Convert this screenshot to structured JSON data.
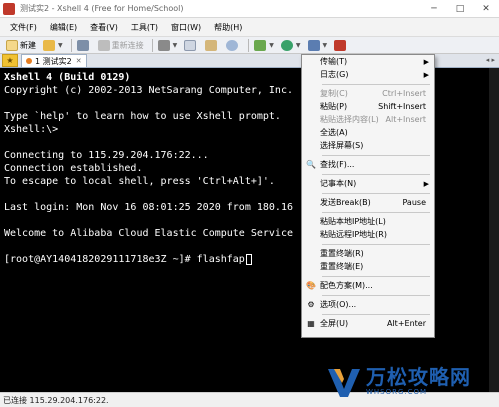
{
  "window": {
    "title": "测试实2 - Xshell 4 (Free for Home/School)",
    "minimize_glyph": "─",
    "maximize_glyph": "□",
    "close_glyph": "✕"
  },
  "menubar": {
    "items": [
      "文件(F)",
      "编辑(E)",
      "查看(V)",
      "工具(T)",
      "窗口(W)",
      "帮助(H)"
    ]
  },
  "toolbar": {
    "new_label": "新建",
    "reconnect_label": "重新连接"
  },
  "tabs": {
    "active_label": "1 测试实2",
    "close_glyph": "✕",
    "nav_glyph": "◂ ▸"
  },
  "terminal": {
    "lines": [
      "Xshell 4 (Build 0129)",
      "Copyright (c) 2002-2013 NetSarang Computer, Inc.",
      "",
      "Type `help' to learn how to use Xshell prompt.",
      "Xshell:\\>",
      "",
      "Connecting to 115.29.204.176:22...",
      "Connection established.",
      "To escape to local shell, press 'Ctrl+Alt+]'.",
      "",
      "Last login: Mon Nov 16 08:01:25 2020 from 180.16",
      "",
      "Welcome to Alibaba Cloud Elastic Compute Service",
      "",
      "[root@AY1404182029111718e3Z ~]# flashfap"
    ]
  },
  "context_menu": {
    "items": [
      {
        "label": "传输(T)",
        "shortcut": "",
        "submenu": true,
        "disabled": false
      },
      {
        "label": "日志(G)",
        "shortcut": "",
        "submenu": true,
        "disabled": false
      },
      {
        "sep": true
      },
      {
        "label": "复制(C)",
        "shortcut": "Ctrl+Insert",
        "submenu": false,
        "disabled": true
      },
      {
        "label": "粘贴(P)",
        "shortcut": "Shift+Insert",
        "submenu": false,
        "disabled": false
      },
      {
        "label": "粘贴选择内容(L)",
        "shortcut": "Alt+Insert",
        "submenu": false,
        "disabled": true
      },
      {
        "label": "全选(A)",
        "shortcut": "",
        "submenu": false,
        "disabled": false
      },
      {
        "label": "选择屏幕(S)",
        "shortcut": "",
        "submenu": false,
        "disabled": false
      },
      {
        "sep": true
      },
      {
        "label": "查找(F)...",
        "shortcut": "",
        "submenu": false,
        "disabled": false,
        "icon": "🔍"
      },
      {
        "sep": true
      },
      {
        "label": "记事本(N)",
        "shortcut": "",
        "submenu": true,
        "disabled": false
      },
      {
        "sep": true
      },
      {
        "label": "发送Break(B)",
        "shortcut": "Pause",
        "submenu": false,
        "disabled": false
      },
      {
        "sep": true
      },
      {
        "label": "粘贴本地IP地址(L)",
        "shortcut": "",
        "submenu": false,
        "disabled": false
      },
      {
        "label": "粘贴远程IP地址(R)",
        "shortcut": "",
        "submenu": false,
        "disabled": false
      },
      {
        "sep": true
      },
      {
        "label": "重置终端(R)",
        "shortcut": "",
        "submenu": false,
        "disabled": false
      },
      {
        "label": "重置终端(E)",
        "shortcut": "",
        "submenu": false,
        "disabled": false
      },
      {
        "sep": true
      },
      {
        "label": "配色方案(M)...",
        "shortcut": "",
        "submenu": false,
        "disabled": false,
        "icon": "🎨"
      },
      {
        "sep": true
      },
      {
        "label": "选项(O)...",
        "shortcut": "",
        "submenu": false,
        "disabled": false,
        "icon": "⚙"
      },
      {
        "sep": true
      },
      {
        "label": "全屏(U)",
        "shortcut": "Alt+Enter",
        "submenu": false,
        "disabled": false,
        "icon": "▦"
      }
    ]
  },
  "statusbar": {
    "text": "已连接 115.29.204.176:22."
  },
  "watermark": {
    "title": "万松攻略网",
    "subtitle": "WHSORG.COM"
  },
  "colors": {
    "terminal_bg": "#000000",
    "terminal_fg": "#ffffff",
    "watermark_blue": "#1f5fb0",
    "tab_home_yellow": "#f1c232"
  }
}
